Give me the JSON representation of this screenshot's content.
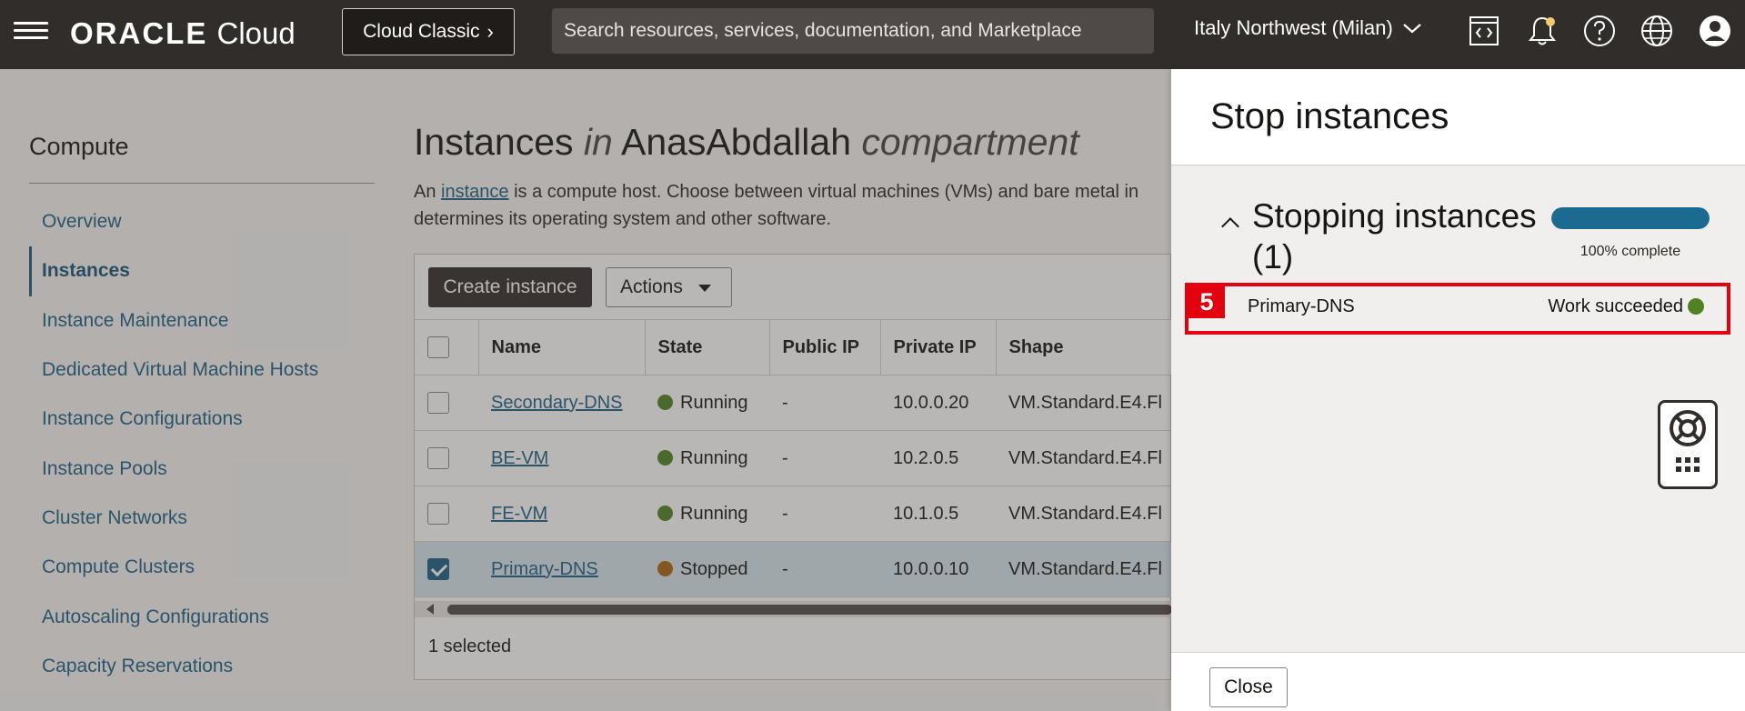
{
  "header": {
    "brand_oracle": "ORACLE",
    "brand_cloud": "Cloud",
    "classic_button": "Cloud Classic",
    "search_placeholder": "Search resources, services, documentation, and Marketplace",
    "region": "Italy Northwest (Milan)",
    "icons": [
      "code-editor-icon",
      "bell-icon",
      "help-icon",
      "globe-icon",
      "user-icon"
    ],
    "bar_color": "#312d2a"
  },
  "sidebar": {
    "title": "Compute",
    "items": [
      {
        "label": "Overview",
        "active": false
      },
      {
        "label": "Instances",
        "active": true
      },
      {
        "label": "Instance Maintenance",
        "active": false
      },
      {
        "label": "Dedicated Virtual Machine Hosts",
        "active": false
      },
      {
        "label": "Instance Configurations",
        "active": false
      },
      {
        "label": "Instance Pools",
        "active": false
      },
      {
        "label": "Cluster Networks",
        "active": false
      },
      {
        "label": "Compute Clusters",
        "active": false
      },
      {
        "label": "Autoscaling Configurations",
        "active": false
      },
      {
        "label": "Capacity Reservations",
        "active": false
      }
    ]
  },
  "main": {
    "title_part1": "Instances",
    "title_in": "in",
    "title_compartment_name": "AnasAbdallah",
    "title_part2": "compartment",
    "desc_pre": "An ",
    "desc_link": "instance",
    "desc_post": " is a compute host. Choose between virtual machines (VMs) and bare metal in",
    "desc_line2": "determines its operating system and other software.",
    "create_button": "Create instance",
    "actions_button": "Actions",
    "columns": [
      "Name",
      "State",
      "Public IP",
      "Private IP",
      "Shape"
    ],
    "rows": [
      {
        "name": "Secondary-DNS",
        "state": "Running",
        "state_color": "#508223",
        "public_ip": "-",
        "private_ip": "10.0.0.20",
        "shape": "VM.Standard.E4.Fl",
        "checked": false
      },
      {
        "name": "BE-VM",
        "state": "Running",
        "state_color": "#508223",
        "public_ip": "-",
        "private_ip": "10.2.0.5",
        "shape": "VM.Standard.E4.Fl",
        "checked": false
      },
      {
        "name": "FE-VM",
        "state": "Running",
        "state_color": "#508223",
        "public_ip": "-",
        "private_ip": "10.1.0.5",
        "shape": "VM.Standard.E4.Fl",
        "checked": false
      },
      {
        "name": "Primary-DNS",
        "state": "Stopped",
        "state_color": "#ac630c",
        "public_ip": "-",
        "private_ip": "10.0.0.10",
        "shape": "VM.Standard.E4.Fl",
        "checked": true
      }
    ],
    "selected_count_text": "1 selected"
  },
  "drawer": {
    "title": "Stop instances",
    "section_heading_line1": "Stopping instances",
    "section_heading_line2": "(1)",
    "progress_fraction": 1.0,
    "progress_label": "100% complete",
    "progress_color": "#1a6a92",
    "step_badge": "5",
    "result_instance": "Primary-DNS",
    "result_status": "Work succeeded",
    "result_status_color": "#508223",
    "close_button": "Close"
  }
}
